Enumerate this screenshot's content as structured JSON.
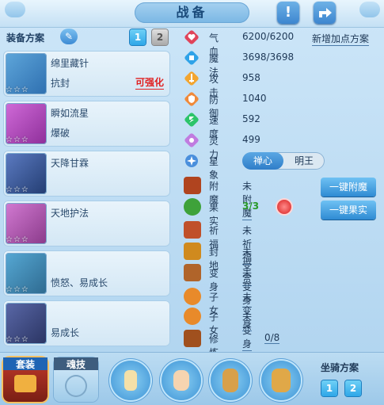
{
  "window": {
    "title": "战备"
  },
  "plans": {
    "label": "装备方案",
    "tabs": [
      "1",
      "2"
    ],
    "active": 0
  },
  "equipment": [
    {
      "name": "绵里藏针",
      "sub": "抗封",
      "upgrade": "可强化",
      "stars": "☆☆☆",
      "color": "#2e6fb0"
    },
    {
      "name": "瞬如流星",
      "sub": "爆破",
      "upgrade": "",
      "stars": "☆☆☆",
      "color": "#8e2f9a"
    },
    {
      "name": "天降甘霖",
      "sub": "",
      "upgrade": "",
      "stars": "☆☆☆",
      "color": "#233d72"
    },
    {
      "name": "天地护法",
      "sub": "",
      "upgrade": "",
      "stars": "☆☆☆",
      "color": "#8a3a8a"
    },
    {
      "name": "",
      "sub": "愤怒、易成长",
      "upgrade": "",
      "stars": "☆☆☆",
      "color": "#2e6a90"
    },
    {
      "name": "",
      "sub": "易成长",
      "upgrade": "",
      "stars": "☆☆☆",
      "color": "#2a3462"
    }
  ],
  "stats": [
    {
      "label": "气血",
      "value": "6200/6200",
      "icon": "heart-icon",
      "color": "#e0445a"
    },
    {
      "label": "魔法",
      "value": "3698/3698",
      "icon": "mana-icon",
      "color": "#2fa3e8"
    },
    {
      "label": "攻击",
      "value": "958",
      "icon": "sword-icon",
      "color": "#f2a530"
    },
    {
      "label": "防御",
      "value": "1040",
      "icon": "shield-icon",
      "color": "#f08a3a"
    },
    {
      "label": "速度",
      "value": "592",
      "icon": "speed-icon",
      "color": "#2cc46a"
    },
    {
      "label": "灵力",
      "value": "499",
      "icon": "spirit-icon",
      "color": "#c07ce0"
    }
  ],
  "add_plan": "新增加点方案",
  "star_sign": {
    "label": "星象",
    "options": [
      "禅心",
      "明王"
    ],
    "selected": 0
  },
  "features": [
    {
      "label": "附魔",
      "value": "未附魔",
      "icon": "enchant-icon",
      "color": "#b0441f"
    },
    {
      "label": "果实",
      "value": "3/3",
      "icon": "fruit-icon",
      "color": "#3ea23a"
    },
    {
      "label": "祈福",
      "value": "未祈福",
      "icon": "blessing-icon",
      "color": "#c0502a"
    },
    {
      "label": "封地",
      "value": "未受赏",
      "icon": "fief-icon",
      "color": "#d08a1e"
    },
    {
      "label": "变身",
      "value": "未变身",
      "icon": "transform-icon",
      "color": "#b0642a"
    },
    {
      "label": "子女",
      "value": "未变身",
      "icon": "child-icon",
      "color": "#e88a2a"
    },
    {
      "label": "子女",
      "value": "未变身",
      "icon": "child-icon",
      "color": "#e88a2a"
    },
    {
      "label": "修炼觉醒",
      "value": "0/8",
      "icon": "awaken-icon",
      "color": "#a0501e"
    }
  ],
  "buttons": {
    "enchant": "一键附魔",
    "fruit": "一键果实"
  },
  "bottom": {
    "tab_suit": "套装",
    "tab_soul": "魂技",
    "mount_label": "坐骑方案",
    "mount_tabs": [
      "1",
      "2"
    ]
  }
}
